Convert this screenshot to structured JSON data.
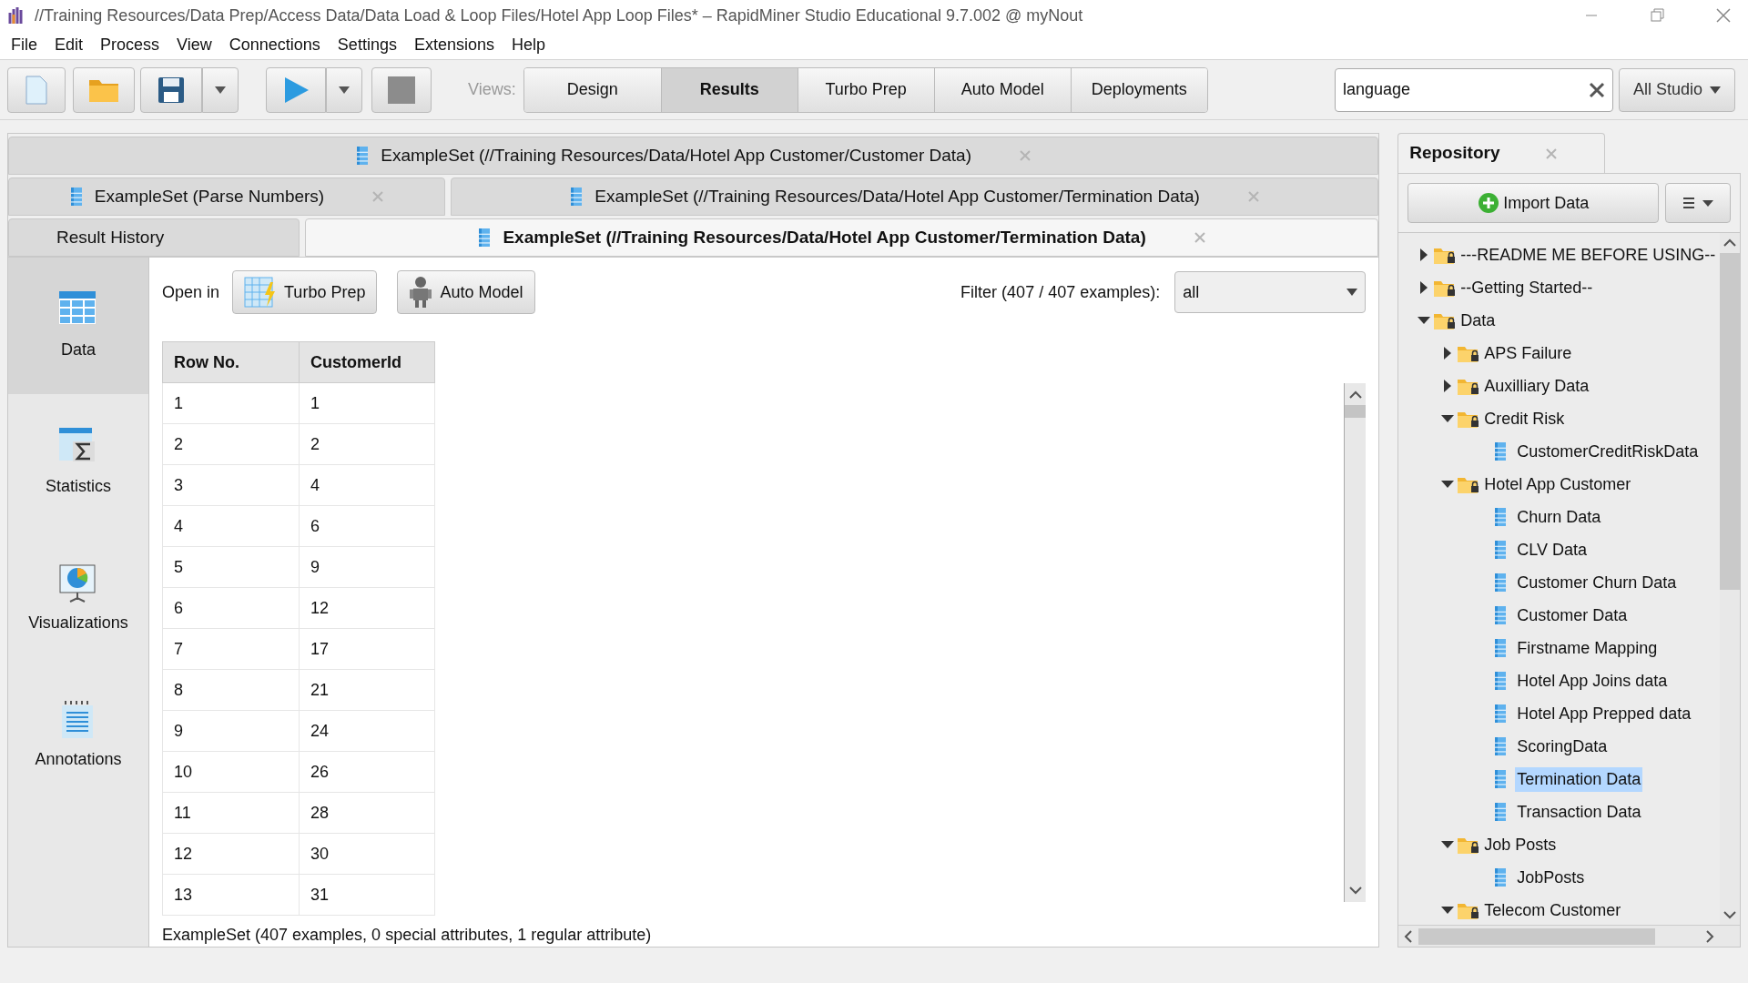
{
  "window": {
    "title": "//Training Resources/Data Prep/Access Data/Data Load & Loop Files/Hotel App Loop Files* – RapidMiner Studio Educational 9.7.002 @ myNout"
  },
  "menu": [
    "File",
    "Edit",
    "Process",
    "View",
    "Connections",
    "Settings",
    "Extensions",
    "Help"
  ],
  "toolbar": {
    "views_label": "Views:",
    "views": [
      {
        "label": "Design",
        "selected": false
      },
      {
        "label": "Results",
        "selected": true
      },
      {
        "label": "Turbo Prep",
        "selected": false
      },
      {
        "label": "Auto Model",
        "selected": false
      },
      {
        "label": "Deployments",
        "selected": false
      }
    ],
    "search": {
      "value": "language"
    },
    "scope": "All Studio"
  },
  "result_tabs": [
    [
      {
        "kind": "exampleset",
        "label": "ExampleSet (//Training Resources/Data/Hotel App Customer/Customer Data)",
        "selected": false
      }
    ],
    [
      {
        "kind": "exampleset",
        "label": "ExampleSet (Parse Numbers)",
        "selected": false
      },
      {
        "kind": "exampleset",
        "label": "ExampleSet (//Training Resources/Data/Hotel App Customer/Termination Data)",
        "selected": false
      }
    ],
    [
      {
        "kind": "history",
        "label": "Result History",
        "selected": false
      },
      {
        "kind": "exampleset",
        "label": "ExampleSet (//Training Resources/Data/Hotel App Customer/Termination Data)",
        "selected": true
      }
    ]
  ],
  "side_views": [
    {
      "kind": "data",
      "label": "Data",
      "selected": true
    },
    {
      "kind": "statistics",
      "label": "Statistics",
      "selected": false
    },
    {
      "kind": "visualizations",
      "label": "Visualizations",
      "selected": false
    },
    {
      "kind": "annotations",
      "label": "Annotations",
      "selected": false
    }
  ],
  "open_in": {
    "label": "Open in",
    "buttons": [
      {
        "kind": "turbo",
        "label": "Turbo Prep"
      },
      {
        "kind": "auto",
        "label": "Auto Model"
      }
    ]
  },
  "filter": {
    "label": "Filter (407 / 407 examples):",
    "value": "all"
  },
  "table": {
    "columns": [
      "Row No.",
      "CustomerId"
    ],
    "rows": [
      [
        "1",
        "1"
      ],
      [
        "2",
        "2"
      ],
      [
        "3",
        "4"
      ],
      [
        "4",
        "6"
      ],
      [
        "5",
        "9"
      ],
      [
        "6",
        "12"
      ],
      [
        "7",
        "17"
      ],
      [
        "8",
        "21"
      ],
      [
        "9",
        "24"
      ],
      [
        "10",
        "26"
      ],
      [
        "11",
        "28"
      ],
      [
        "12",
        "30"
      ],
      [
        "13",
        "31"
      ]
    ]
  },
  "summary": "ExampleSet (407 examples, 0 special attributes, 1 regular attribute)",
  "repository": {
    "title": "Repository",
    "import_button": "Import Data",
    "tree": [
      {
        "kind": "folder",
        "label": "---README ME BEFORE USING--",
        "expanded": false
      },
      {
        "kind": "folder",
        "label": "--Getting Started--",
        "expanded": false
      },
      {
        "kind": "folder",
        "label": "Data",
        "expanded": true,
        "children": [
          {
            "kind": "folder",
            "label": "APS Failure",
            "expanded": false
          },
          {
            "kind": "folder",
            "label": "Auxilliary Data",
            "expanded": false
          },
          {
            "kind": "folder",
            "label": "Credit Risk",
            "expanded": true,
            "children": [
              {
                "kind": "data",
                "label": "CustomerCreditRiskData",
                "selected": false
              }
            ]
          },
          {
            "kind": "folder",
            "label": "Hotel App Customer",
            "expanded": true,
            "children": [
              {
                "kind": "data",
                "label": "Churn Data",
                "selected": false
              },
              {
                "kind": "data",
                "label": "CLV Data",
                "selected": false
              },
              {
                "kind": "data",
                "label": "Customer Churn Data",
                "selected": false
              },
              {
                "kind": "data",
                "label": "Customer Data",
                "selected": false
              },
              {
                "kind": "data",
                "label": "Firstname Mapping",
                "selected": false
              },
              {
                "kind": "data",
                "label": "Hotel App Joins data",
                "selected": false
              },
              {
                "kind": "data",
                "label": "Hotel App Prepped data",
                "selected": false
              },
              {
                "kind": "data",
                "label": "ScoringData",
                "selected": false
              },
              {
                "kind": "data",
                "label": "Termination Data",
                "selected": true
              },
              {
                "kind": "data",
                "label": "Transaction Data",
                "selected": false
              }
            ]
          },
          {
            "kind": "folder",
            "label": "Job Posts",
            "expanded": true,
            "children": [
              {
                "kind": "data",
                "label": "JobPosts",
                "selected": false
              }
            ]
          },
          {
            "kind": "folder",
            "label": "Telecom Customer",
            "expanded": true
          }
        ]
      }
    ]
  }
}
